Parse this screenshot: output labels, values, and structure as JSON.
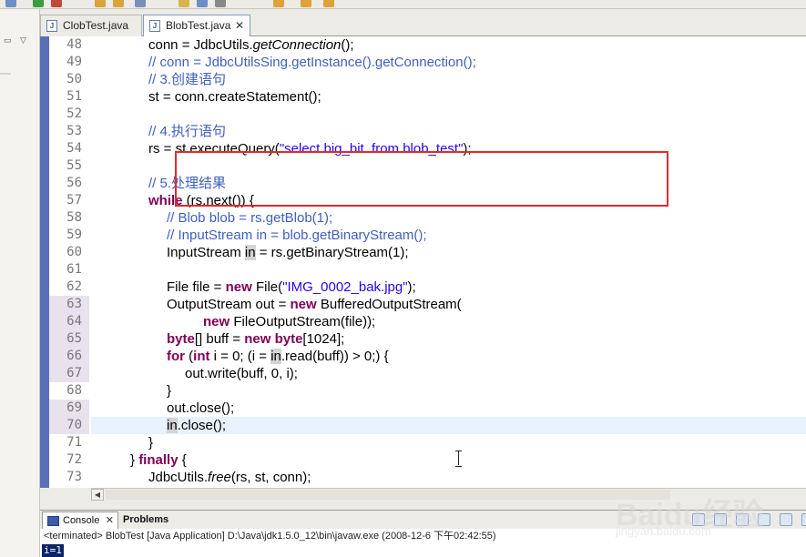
{
  "editor": {
    "tabs": [
      {
        "label": "ClobTest.java",
        "active": false
      },
      {
        "label": "BlobTest.java",
        "active": true
      }
    ],
    "lines": [
      {
        "n": "48",
        "marked": false,
        "current": false
      },
      {
        "n": "49",
        "marked": false,
        "current": false
      },
      {
        "n": "50",
        "marked": false,
        "current": false
      },
      {
        "n": "51",
        "marked": false,
        "current": false
      },
      {
        "n": "52",
        "marked": false,
        "current": false
      },
      {
        "n": "53",
        "marked": false,
        "current": false
      },
      {
        "n": "54",
        "marked": false,
        "current": false
      },
      {
        "n": "55",
        "marked": false,
        "current": false
      },
      {
        "n": "56",
        "marked": false,
        "current": false
      },
      {
        "n": "57",
        "marked": false,
        "current": false
      },
      {
        "n": "58",
        "marked": false,
        "current": false
      },
      {
        "n": "59",
        "marked": false,
        "current": false
      },
      {
        "n": "60",
        "marked": false,
        "current": false
      },
      {
        "n": "61",
        "marked": false,
        "current": false
      },
      {
        "n": "62",
        "marked": false,
        "current": false
      },
      {
        "n": "63",
        "marked": true,
        "current": false
      },
      {
        "n": "64",
        "marked": true,
        "current": false
      },
      {
        "n": "65",
        "marked": true,
        "current": false
      },
      {
        "n": "66",
        "marked": true,
        "current": false
      },
      {
        "n": "67",
        "marked": true,
        "current": false
      },
      {
        "n": "68",
        "marked": false,
        "current": false
      },
      {
        "n": "69",
        "marked": true,
        "current": false
      },
      {
        "n": "70",
        "marked": true,
        "current": true
      },
      {
        "n": "71",
        "marked": false,
        "current": false
      },
      {
        "n": "72",
        "marked": false,
        "current": false
      },
      {
        "n": "73",
        "marked": false,
        "current": false
      }
    ],
    "code": [
      {
        "indent": 3,
        "tokens": [
          {
            "t": "conn = JdbcUtils.",
            "c": ""
          },
          {
            "t": "getConnection",
            "c": "it"
          },
          {
            "t": "();",
            "c": ""
          }
        ]
      },
      {
        "indent": 3,
        "tokens": [
          {
            "t": "// conn = JdbcUtilsSing.getInstance().getConnection();",
            "c": "cm"
          }
        ]
      },
      {
        "indent": 3,
        "tokens": [
          {
            "t": "// 3.创建语句",
            "c": "cm"
          }
        ]
      },
      {
        "indent": 3,
        "tokens": [
          {
            "t": "st = conn.createStatement();",
            "c": ""
          }
        ]
      },
      {
        "indent": 0,
        "tokens": []
      },
      {
        "indent": 3,
        "tokens": [
          {
            "t": "// 4.执行语句",
            "c": "cm"
          }
        ]
      },
      {
        "indent": 3,
        "tokens": [
          {
            "t": "rs = st.executeQuery(",
            "c": ""
          },
          {
            "t": "\"select big_bit  from blob_test\"",
            "c": "str"
          },
          {
            "t": ");",
            "c": ""
          }
        ]
      },
      {
        "indent": 0,
        "tokens": []
      },
      {
        "indent": 3,
        "tokens": [
          {
            "t": "// 5.处理结果",
            "c": "cm"
          }
        ]
      },
      {
        "indent": 3,
        "tokens": [
          {
            "t": "while",
            "c": "kw"
          },
          {
            "t": " (rs.next()) {",
            "c": ""
          }
        ]
      },
      {
        "indent": 4,
        "tokens": [
          {
            "t": "// Blob blob = rs.getBlob(1);",
            "c": "cm"
          }
        ]
      },
      {
        "indent": 4,
        "tokens": [
          {
            "t": "// InputStream in = blob.getBinaryStream();",
            "c": "cm"
          }
        ]
      },
      {
        "indent": 4,
        "tokens": [
          {
            "t": "InputStream ",
            "c": ""
          },
          {
            "t": "in",
            "c": "hl"
          },
          {
            "t": " = rs.getBinaryStream(1);",
            "c": ""
          }
        ]
      },
      {
        "indent": 0,
        "tokens": []
      },
      {
        "indent": 4,
        "tokens": [
          {
            "t": "File file = ",
            "c": ""
          },
          {
            "t": "new",
            "c": "kw"
          },
          {
            "t": " File(",
            "c": ""
          },
          {
            "t": "\"IMG_0002_bak.jpg\"",
            "c": "str"
          },
          {
            "t": ");",
            "c": ""
          }
        ]
      },
      {
        "indent": 4,
        "tokens": [
          {
            "t": "OutputStream out = ",
            "c": ""
          },
          {
            "t": "new",
            "c": "kw"
          },
          {
            "t": " BufferedOutputStream(",
            "c": ""
          }
        ]
      },
      {
        "indent": 6,
        "tokens": [
          {
            "t": "new",
            "c": "kw"
          },
          {
            "t": " FileOutputStream(file));",
            "c": ""
          }
        ]
      },
      {
        "indent": 4,
        "tokens": [
          {
            "t": "byte",
            "c": "kw"
          },
          {
            "t": "[] buff = ",
            "c": ""
          },
          {
            "t": "new",
            "c": "kw"
          },
          {
            "t": " ",
            "c": ""
          },
          {
            "t": "byte",
            "c": "kw"
          },
          {
            "t": "[1024];",
            "c": ""
          }
        ]
      },
      {
        "indent": 4,
        "tokens": [
          {
            "t": "for",
            "c": "kw"
          },
          {
            "t": " (",
            "c": ""
          },
          {
            "t": "int",
            "c": "kw"
          },
          {
            "t": " i = 0; (i = ",
            "c": ""
          },
          {
            "t": "in",
            "c": "hl"
          },
          {
            "t": ".read(buff)) > 0;) {",
            "c": ""
          }
        ]
      },
      {
        "indent": 5,
        "tokens": [
          {
            "t": "out.write(buff, 0, i);",
            "c": ""
          }
        ]
      },
      {
        "indent": 4,
        "tokens": [
          {
            "t": "}",
            "c": ""
          }
        ]
      },
      {
        "indent": 4,
        "tokens": [
          {
            "t": "out.close();",
            "c": ""
          }
        ]
      },
      {
        "indent": 4,
        "tokens": [
          {
            "t": "in",
            "c": "hl"
          },
          {
            "t": ".close();",
            "c": ""
          }
        ]
      },
      {
        "indent": 3,
        "tokens": [
          {
            "t": "}",
            "c": ""
          }
        ]
      },
      {
        "indent": 2,
        "tokens": [
          {
            "t": "} ",
            "c": ""
          },
          {
            "t": "finally",
            "c": "kw"
          },
          {
            "t": " {",
            "c": ""
          }
        ]
      },
      {
        "indent": 3,
        "tokens": [
          {
            "t": "JdbcUtils.",
            "c": ""
          },
          {
            "t": "free",
            "c": "it"
          },
          {
            "t": "(rs, st, conn);",
            "c": ""
          }
        ]
      }
    ]
  },
  "console": {
    "tabs": [
      {
        "label": "Console",
        "active": true
      },
      {
        "label": "Problems",
        "active": false
      }
    ],
    "status": "<terminated> BlobTest [Java Application] D:\\Java\\jdk1.5.0_12\\bin\\javaw.exe (2008-12-6 下午02:42:55)",
    "output": "i=1"
  },
  "colors": {
    "highlight_box": "#e02b2b",
    "keyword": "#7f0055",
    "comment": "#3f5fbf",
    "string": "#2a00ff"
  },
  "watermark": {
    "logo": "Baidu经验",
    "sub": "jingyan.baidu.com"
  }
}
